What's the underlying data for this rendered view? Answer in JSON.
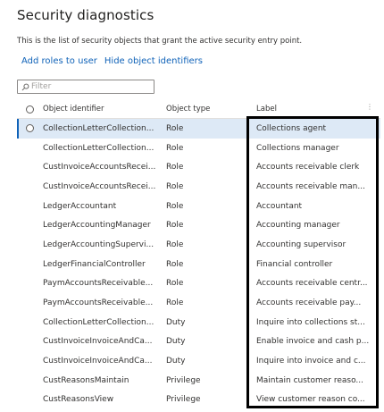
{
  "title": "Security diagnostics",
  "description": "This is the list of security objects that grant the active security entry point.",
  "actions": {
    "add_roles": "Add roles to user",
    "hide_identifiers": "Hide object identifiers"
  },
  "filter": {
    "placeholder": "Filter",
    "value": ""
  },
  "table": {
    "columns": {
      "identifier": "Object identifier",
      "type": "Object type",
      "label": "Label"
    },
    "rows": [
      {
        "id": "CollectionLetterCollection...",
        "type": "Role",
        "label": "Collections agent"
      },
      {
        "id": "CollectionLetterCollection...",
        "type": "Role",
        "label": "Collections manager"
      },
      {
        "id": "CustInvoiceAccountsRecei...",
        "type": "Role",
        "label": "Accounts receivable clerk"
      },
      {
        "id": "CustInvoiceAccountsRecei...",
        "type": "Role",
        "label": "Accounts receivable man..."
      },
      {
        "id": "LedgerAccountant",
        "type": "Role",
        "label": "Accountant"
      },
      {
        "id": "LedgerAccountingManager",
        "type": "Role",
        "label": "Accounting manager"
      },
      {
        "id": "LedgerAccountingSupervi...",
        "type": "Role",
        "label": "Accounting supervisor"
      },
      {
        "id": "LedgerFinancialController",
        "type": "Role",
        "label": "Financial controller"
      },
      {
        "id": "PaymAccountsReceivable...",
        "type": "Role",
        "label": "Accounts receivable centr..."
      },
      {
        "id": "PaymAccountsReceivable...",
        "type": "Role",
        "label": "Accounts receivable pay..."
      },
      {
        "id": "CollectionLetterCollection...",
        "type": "Duty",
        "label": "Inquire into collections st..."
      },
      {
        "id": "CustInvoiceInvoiceAndCa...",
        "type": "Duty",
        "label": "Enable invoice and cash p..."
      },
      {
        "id": "CustInvoiceInvoiceAndCa...",
        "type": "Duty",
        "label": "Inquire into invoice and c..."
      },
      {
        "id": "CustReasonsMaintain",
        "type": "Privilege",
        "label": "Maintain customer reaso..."
      },
      {
        "id": "CustReasonsView",
        "type": "Privilege",
        "label": "View customer reason co..."
      }
    ]
  },
  "selected_row_index": 0,
  "colors": {
    "accent": "#0f62b8",
    "selected_bg": "#dde9f6",
    "highlight_border": "#000000"
  }
}
